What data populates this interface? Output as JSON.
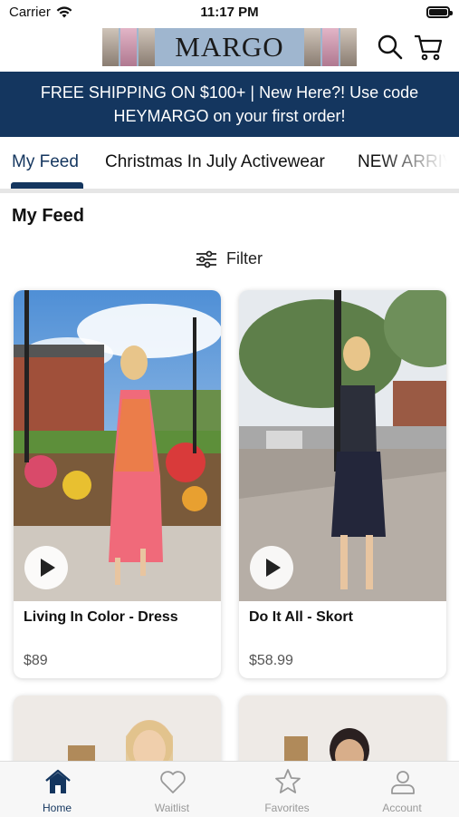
{
  "status_bar": {
    "carrier": "Carrier",
    "time": "11:17 PM"
  },
  "header": {
    "logo": "MARGO",
    "search_icon": "search-icon",
    "cart_icon": "cart-icon"
  },
  "promo": {
    "line1": "FREE SHIPPING ON $100+ | New Here?! Use code",
    "line2": "HEYMARGO on your first order!"
  },
  "tabs": [
    {
      "label": "My Feed",
      "active": true
    },
    {
      "label": "Christmas In July Activewear",
      "active": false
    },
    {
      "label": "NEW ARRIVALS",
      "active": false
    }
  ],
  "feed": {
    "title": "My Feed",
    "filter_label": "Filter"
  },
  "products": [
    {
      "name": "Living In Color - Dress",
      "price": "$89"
    },
    {
      "name": "Do It All - Skort",
      "price": "$58.99"
    }
  ],
  "bottom_nav": [
    {
      "label": "Home",
      "icon": "home-icon",
      "active": true
    },
    {
      "label": "Waitlist",
      "icon": "heart-icon",
      "active": false
    },
    {
      "label": "Favorites",
      "icon": "star-icon",
      "active": false
    },
    {
      "label": "Account",
      "icon": "person-icon",
      "active": false
    }
  ],
  "colors": {
    "primary": "#14365f",
    "promo_bg": "#14365f",
    "inactive": "#999999"
  }
}
